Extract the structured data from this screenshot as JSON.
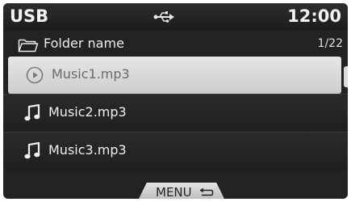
{
  "statusbar": {
    "title": "USB",
    "time": "12:00",
    "source_icon": "usb-icon"
  },
  "folder": {
    "icon": "folder-icon",
    "name": "Folder name",
    "page_indicator": "1/22"
  },
  "tracks": [
    {
      "label": "Music1.mp3",
      "icon": "play-circle-icon",
      "selected": true
    },
    {
      "label": "Music2.mp3",
      "icon": "music-note-icon",
      "selected": false
    },
    {
      "label": "Music3.mp3",
      "icon": "music-note-icon",
      "selected": false
    }
  ],
  "menu": {
    "label": "MENU",
    "icon": "back-arrow-icon"
  },
  "colors": {
    "background": "#222222",
    "selected_row": "#d8d8d8",
    "text": "#f0f0f0",
    "selected_text": "#6a6a6a"
  }
}
